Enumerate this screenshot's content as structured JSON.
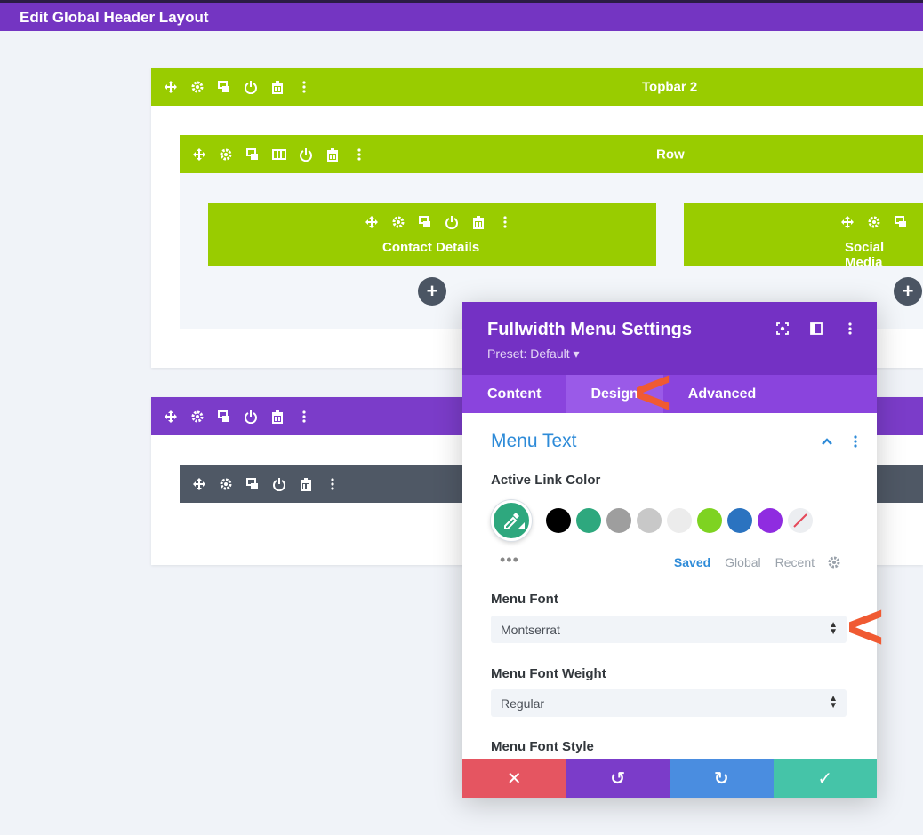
{
  "header": {
    "title": "Edit Global Header Layout"
  },
  "sections": [
    {
      "label": "Topbar 2",
      "color": "#99cc00"
    },
    {
      "label": "",
      "color": "#7b3cc9"
    }
  ],
  "row": {
    "label": "Row"
  },
  "modules": [
    {
      "label": "Contact Details"
    },
    {
      "label": "Social Media"
    }
  ],
  "add_symbol": "+",
  "panel": {
    "title": "Fullwidth Menu Settings",
    "preset": "Preset: Default ▾",
    "tabs": [
      "Content",
      "Design",
      "Advanced"
    ],
    "active_tab": "Design",
    "section_title": "Menu Text",
    "active_link_color_label": "Active Link Color",
    "swatches": [
      "#000000",
      "#2ea87e",
      "#9e9e9e",
      "#c8c8c8",
      "#ececec",
      "#7ed321",
      "#2b73c0",
      "#8f2ce0",
      "transparent"
    ],
    "selected_color": "#2ea87e",
    "more_dots": "•••",
    "palette_tabs": [
      "Saved",
      "Global",
      "Recent"
    ],
    "menu_font_label": "Menu Font",
    "menu_font_value": "Montserrat",
    "menu_font_weight_label": "Menu Font Weight",
    "menu_font_weight_value": "Regular",
    "menu_font_style_label": "Menu Font Style",
    "footer_colors": [
      "#e55561",
      "#7b3cc9",
      "#4a8de0",
      "#45c4a8"
    ]
  },
  "annotation_arrow": "<"
}
